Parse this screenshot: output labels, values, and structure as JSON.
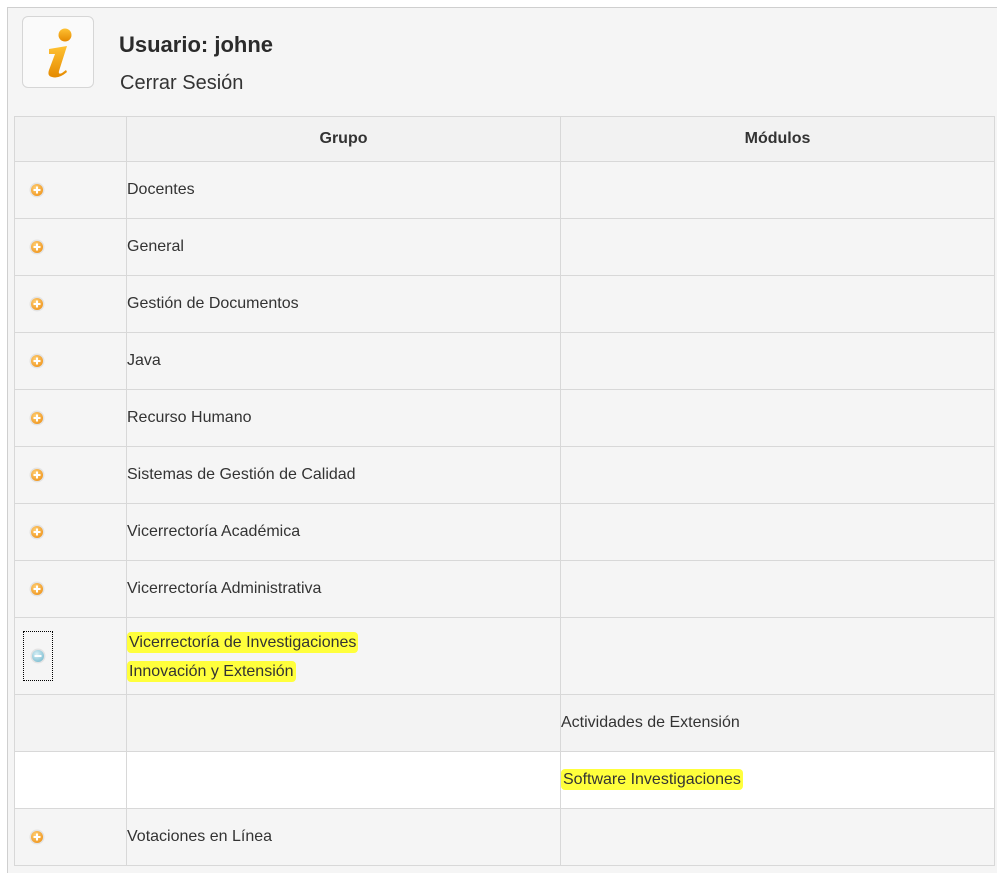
{
  "header": {
    "user_label": "Usuario: johne",
    "logout_label": "Cerrar Sesión",
    "icon": "info-icon"
  },
  "table": {
    "columns": [
      "",
      "Grupo",
      "Módulos"
    ],
    "rows": [
      {
        "icon": "plus-circle-icon",
        "group": "Docentes",
        "module": ""
      },
      {
        "icon": "plus-circle-icon",
        "group": "General",
        "module": ""
      },
      {
        "icon": "plus-circle-icon",
        "group": "Gestión de Documentos",
        "module": ""
      },
      {
        "icon": "plus-circle-icon",
        "group": "Java",
        "module": ""
      },
      {
        "icon": "plus-circle-icon",
        "group": "Recurso Humano",
        "module": ""
      },
      {
        "icon": "plus-circle-icon",
        "group": "Sistemas de Gestión de Calidad",
        "module": ""
      },
      {
        "icon": "plus-circle-icon",
        "group": "Vicerrectoría Académica",
        "module": ""
      },
      {
        "icon": "plus-circle-icon",
        "group": "Vicerrectoría Administrativa",
        "module": ""
      },
      {
        "icon": "minus-circle-icon",
        "group_line1": "Vicerrectoría de Investigaciones",
        "group_line2": "Innovación y Extensión",
        "module": "",
        "expanded": true,
        "highlighted": true
      },
      {
        "sub": true,
        "group": "",
        "module": "Actividades de Extensión"
      },
      {
        "sub": true,
        "group": "",
        "module": "Software Investigaciones",
        "highlighted": true
      },
      {
        "icon": "plus-circle-icon",
        "group": "Votaciones en Línea",
        "module": ""
      }
    ]
  },
  "colors": {
    "accent_orange": "#f7a531",
    "expand_blue": "#8ec6d6",
    "highlight": "#ffff3c"
  }
}
